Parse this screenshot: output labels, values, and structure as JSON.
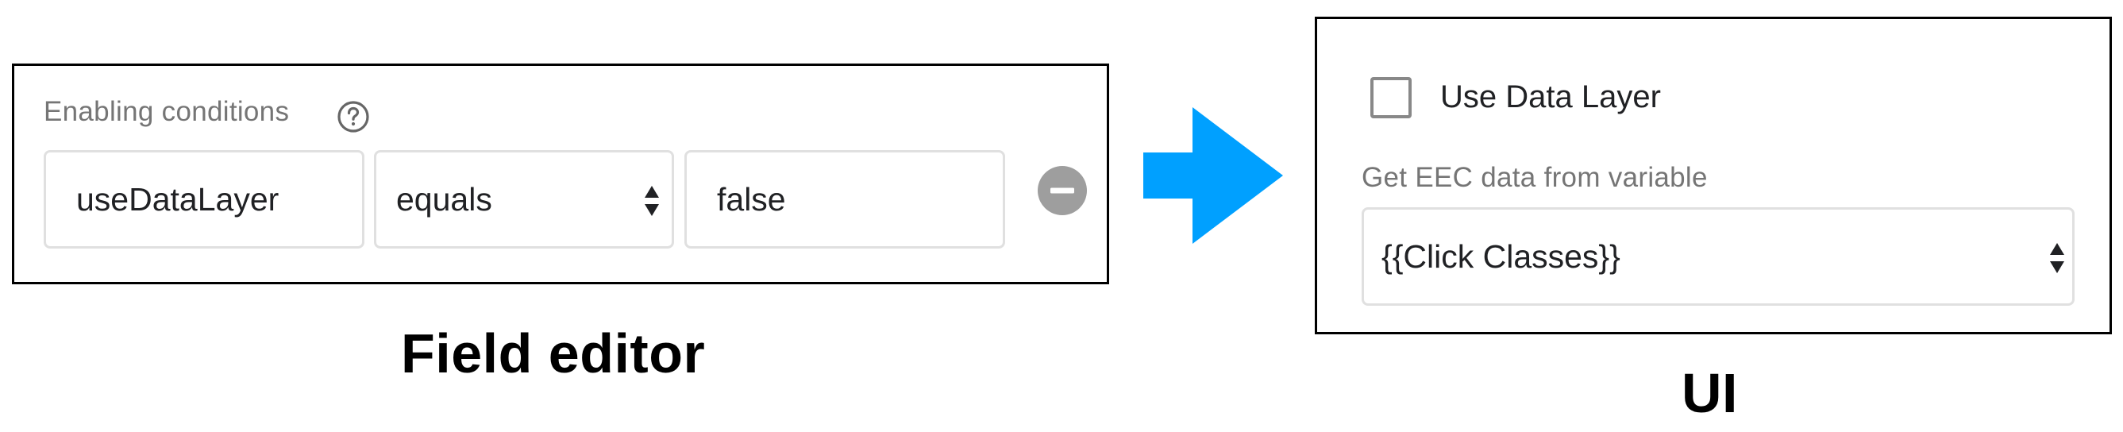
{
  "field_editor": {
    "section_label": "Enabling conditions",
    "help_icon": "help-circle-icon",
    "condition_field": "useDataLayer",
    "operator": {
      "selected": "equals",
      "icon": "select-arrows-icon"
    },
    "value_field": "false",
    "remove_icon": "remove-circle-icon",
    "caption": "Field editor"
  },
  "arrow": {
    "icon": "right-arrow-icon",
    "color": "#00a0ff"
  },
  "ui_preview": {
    "checkbox_label": "Use Data Layer",
    "checkbox_checked": false,
    "variable_label": "Get EEC data from variable",
    "variable_select": {
      "selected": "{{Click Classes}}",
      "icon": "select-arrows-icon"
    },
    "caption": "UI"
  },
  "colors": {
    "field_border": "#e0e0e0",
    "label_gray": "#757575",
    "remove_icon_gray": "#9e9e9e",
    "checkbox_border": "#888888",
    "panel_border": "#000000"
  }
}
